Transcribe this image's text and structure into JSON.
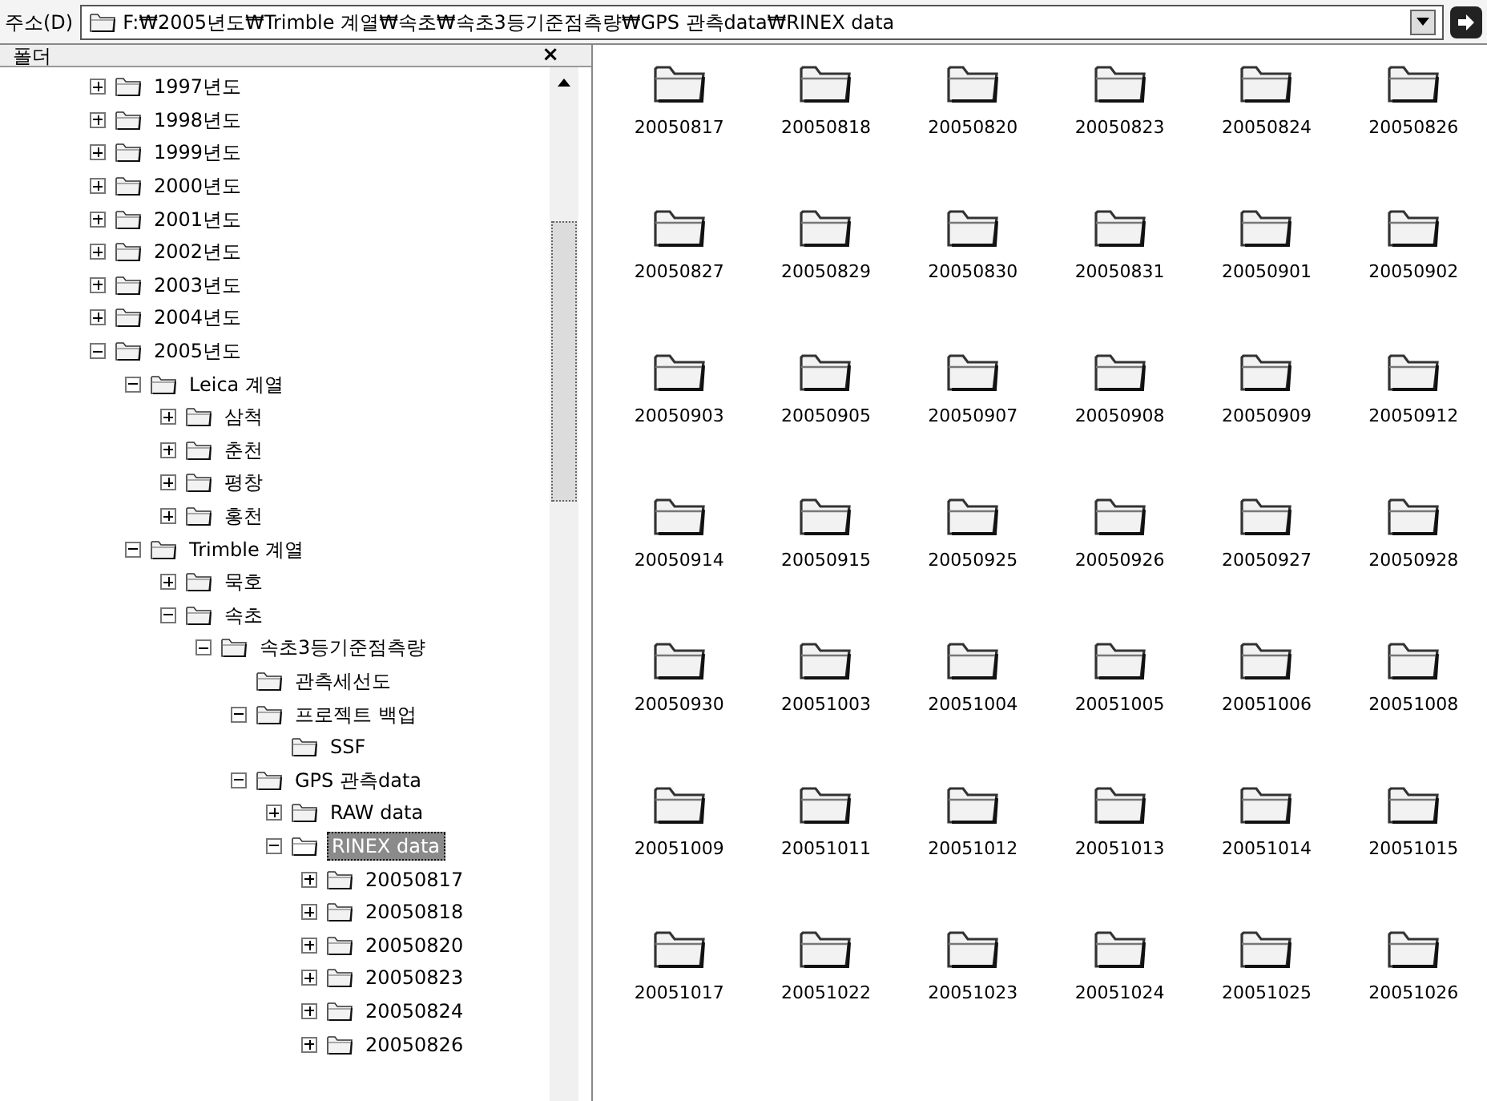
{
  "address_bar": {
    "label": "주소(D)",
    "value": "F:₩2005년도₩Trimble 계열₩속초₩속초3등기준점측량₩GPS 관측data₩RINEX data"
  },
  "folders_pane": {
    "title": "폴더",
    "close": "×"
  },
  "tree": [
    {
      "label": "1997년도",
      "kind": "branch",
      "expanded": false,
      "selected": false
    },
    {
      "label": "1998년도",
      "kind": "branch",
      "expanded": false,
      "selected": false
    },
    {
      "label": "1999년도",
      "kind": "branch",
      "expanded": false,
      "selected": false
    },
    {
      "label": "2000년도",
      "kind": "branch",
      "expanded": false,
      "selected": false
    },
    {
      "label": "2001년도",
      "kind": "branch",
      "expanded": false,
      "selected": false
    },
    {
      "label": "2002년도",
      "kind": "branch",
      "expanded": false,
      "selected": false
    },
    {
      "label": "2003년도",
      "kind": "branch",
      "expanded": false,
      "selected": false
    },
    {
      "label": "2004년도",
      "kind": "branch",
      "expanded": false,
      "selected": false
    },
    {
      "label": "2005년도",
      "kind": "branch",
      "expanded": true,
      "selected": false,
      "children": [
        {
          "label": "Leica 계열",
          "kind": "branch",
          "expanded": true,
          "selected": false,
          "children": [
            {
              "label": "삼척",
              "kind": "branch",
              "expanded": false,
              "selected": false
            },
            {
              "label": "춘천",
              "kind": "branch",
              "expanded": false,
              "selected": false
            },
            {
              "label": "평창",
              "kind": "branch",
              "expanded": false,
              "selected": false
            },
            {
              "label": "홍천",
              "kind": "branch",
              "expanded": false,
              "selected": false
            }
          ]
        },
        {
          "label": "Trimble 계열",
          "kind": "branch",
          "expanded": true,
          "selected": false,
          "children": [
            {
              "label": "묵호",
              "kind": "branch",
              "expanded": false,
              "selected": false
            },
            {
              "label": "속초",
              "kind": "branch",
              "expanded": true,
              "selected": false,
              "children": [
                {
                  "label": "속초3등기준점측량",
                  "kind": "branch",
                  "expanded": true,
                  "selected": false,
                  "children": [
                    {
                      "label": "관측세선도",
                      "kind": "leaf",
                      "selected": false
                    },
                    {
                      "label": "프로젝트 백업",
                      "kind": "branch",
                      "expanded": true,
                      "selected": false,
                      "children": [
                        {
                          "label": "SSF",
                          "kind": "leaf",
                          "selected": false
                        }
                      ]
                    },
                    {
                      "label": "GPS 관측data",
                      "kind": "branch",
                      "expanded": true,
                      "selected": false,
                      "children": [
                        {
                          "label": "RAW data",
                          "kind": "branch",
                          "expanded": false,
                          "selected": false
                        },
                        {
                          "label": "RINEX data",
                          "kind": "branch",
                          "expanded": true,
                          "selected": true,
                          "children": [
                            {
                              "label": "20050817",
                              "kind": "branch",
                              "expanded": false,
                              "selected": false
                            },
                            {
                              "label": "20050818",
                              "kind": "branch",
                              "expanded": false,
                              "selected": false
                            },
                            {
                              "label": "20050820",
                              "kind": "branch",
                              "expanded": false,
                              "selected": false
                            },
                            {
                              "label": "20050823",
                              "kind": "branch",
                              "expanded": false,
                              "selected": false
                            },
                            {
                              "label": "20050824",
                              "kind": "branch",
                              "expanded": false,
                              "selected": false
                            },
                            {
                              "label": "20050826",
                              "kind": "branch",
                              "expanded": false,
                              "selected": false
                            }
                          ]
                        }
                      ]
                    }
                  ]
                }
              ]
            }
          ]
        }
      ]
    }
  ],
  "folder_items": [
    "20050817",
    "20050818",
    "20050820",
    "20050823",
    "20050824",
    "20050826",
    "20050827",
    "20050829",
    "20050830",
    "20050831",
    "20050901",
    "20050902",
    "20050903",
    "20050905",
    "20050907",
    "20050908",
    "20050909",
    "20050912",
    "20050914",
    "20050915",
    "20050925",
    "20050926",
    "20050927",
    "20050928",
    "20050930",
    "20051003",
    "20051004",
    "20051005",
    "20051006",
    "20051008",
    "20051009",
    "20051011",
    "20051012",
    "20051013",
    "20051014",
    "20051015",
    "20051017",
    "20051022",
    "20051023",
    "20051024",
    "20051025",
    "20051026"
  ]
}
